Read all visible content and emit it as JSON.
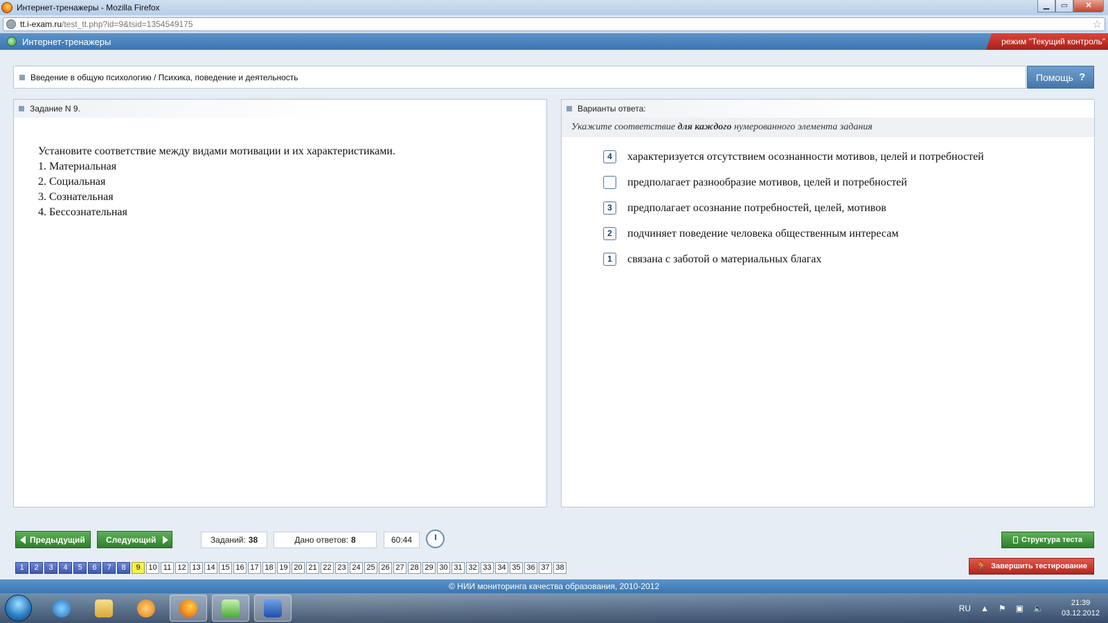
{
  "window": {
    "title": "Интернет-тренажеры - Mozilla Firefox",
    "btn_min": "▁",
    "btn_max": "▭",
    "btn_close": "✕"
  },
  "urlbar": {
    "host": "tt.i-exam.ru",
    "path": "/test_tt.php?id=9&tsid=1354549175"
  },
  "app": {
    "title": "Интернет-тренажеры",
    "mode": "режим \"Текущий контроль\""
  },
  "breadcrumb": "Введение в общую психологию / Психика, поведение и деятельность",
  "help": {
    "label": "Помощь",
    "icon": "?"
  },
  "task": {
    "header": "Задание N 9.",
    "question": "Установите соответствие между видами мотивации и их характеристиками.",
    "items": [
      "1. Материальная",
      "2. Социальная",
      "3. Сознательная",
      "4. Бессознательная"
    ]
  },
  "answers": {
    "header": "Варианты ответа:",
    "instruction_pre": "Укажите соответствие ",
    "instruction_bold": "для каждого",
    "instruction_post": " нумерованного элемента задания",
    "rows": [
      {
        "value": "4",
        "text": "характеризуется отсутствием осознанности мотивов, целей и потребностей"
      },
      {
        "value": "",
        "text": "предполагает разнообразие мотивов, целей и потребностей"
      },
      {
        "value": "3",
        "text": "предполагает осознание потребностей, целей, мотивов"
      },
      {
        "value": "2",
        "text": "подчиняет поведение человека общественным интересам"
      },
      {
        "value": "1",
        "text": "связана с заботой о материальных благах"
      }
    ]
  },
  "controls": {
    "prev": "Предыдущий",
    "next": "Следующий",
    "tasks_label": "Заданий:",
    "tasks_count": "38",
    "answered_label": "Дано ответов:",
    "answered_count": "8",
    "timer": "60:44",
    "structure": "Структура теста",
    "finish": "Завершить тестирование"
  },
  "pager": {
    "pages": [
      "1",
      "2",
      "3",
      "4",
      "5",
      "6",
      "7",
      "8",
      "9",
      "10",
      "11",
      "12",
      "13",
      "14",
      "15",
      "16",
      "17",
      "18",
      "19",
      "20",
      "21",
      "22",
      "23",
      "24",
      "25",
      "26",
      "27",
      "28",
      "29",
      "30",
      "31",
      "32",
      "33",
      "34",
      "35",
      "36",
      "37",
      "38"
    ],
    "answered_through": 8,
    "current": 9
  },
  "footer": "© НИИ мониторинга качества образования, 2010-2012",
  "taskbar": {
    "lang": "RU",
    "time": "21:39",
    "date": "03.12.2012",
    "tray_arrow": "▲",
    "flag_icon": "⚑",
    "network_icon": "▣",
    "volume_icon": "🔈"
  }
}
